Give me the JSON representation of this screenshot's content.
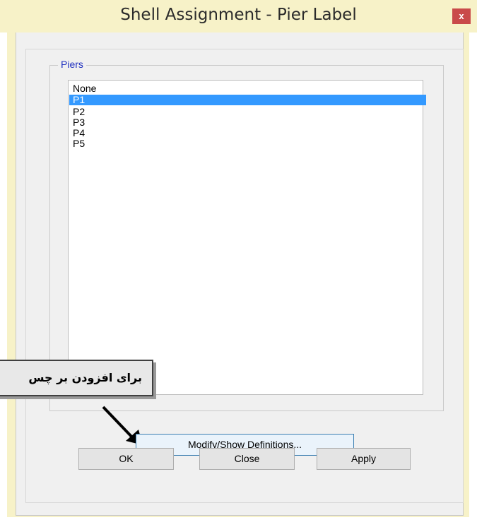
{
  "window": {
    "title": "Shell Assignment - Pier Label",
    "close_glyph": "x"
  },
  "piers": {
    "label": "Piers",
    "items": [
      "None",
      "P1",
      "P2",
      "P3",
      "P4",
      "P5"
    ],
    "selected": "P1"
  },
  "callout": {
    "text": "برای افزودن بر چس"
  },
  "buttons": {
    "modify": "Modify/Show Definitions...",
    "ok": "OK",
    "close": "Close",
    "apply": "Apply"
  },
  "colors": {
    "selection": "#3399ff",
    "group_label": "#1e2fbf",
    "title_close_button": "#c94a4a",
    "frame": "#f7f2c8"
  }
}
